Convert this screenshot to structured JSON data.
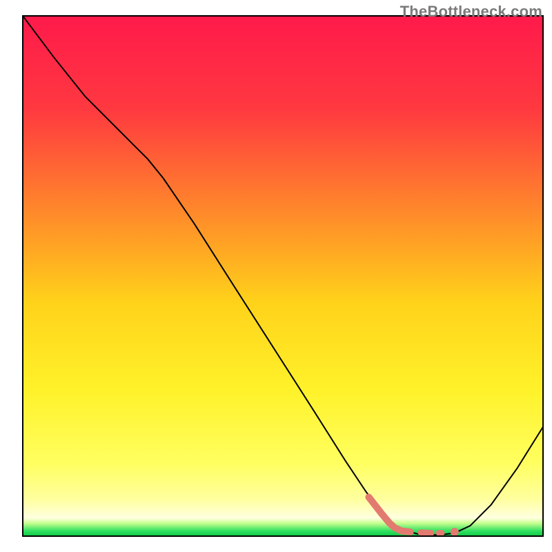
{
  "watermark": "TheBottleneck.com",
  "chart_data": {
    "type": "line",
    "title": "",
    "xlabel": "",
    "ylabel": "",
    "xlim": [
      0,
      100
    ],
    "ylim": [
      0,
      100
    ],
    "x_plot_range": [
      33,
      787
    ],
    "y_plot_range": [
      23,
      777
    ],
    "gradient_stops": [
      {
        "offset": 0.0,
        "color": "#ff1a4b"
      },
      {
        "offset": 0.18,
        "color": "#ff3940"
      },
      {
        "offset": 0.38,
        "color": "#ff8a2a"
      },
      {
        "offset": 0.55,
        "color": "#ffd21a"
      },
      {
        "offset": 0.72,
        "color": "#fff22a"
      },
      {
        "offset": 0.86,
        "color": "#ffff60"
      },
      {
        "offset": 0.93,
        "color": "#ffffa0"
      },
      {
        "offset": 0.965,
        "color": "#ffffe0"
      },
      {
        "offset": 0.975,
        "color": "#c8ff90"
      },
      {
        "offset": 0.99,
        "color": "#30e060"
      },
      {
        "offset": 1.0,
        "color": "#10c848"
      }
    ],
    "series": [
      {
        "name": "bottleneck-curve",
        "stroke": "#000000",
        "stroke_width": 2.0,
        "points": [
          {
            "x": 0.0,
            "y": 100.0
          },
          {
            "x": 6.0,
            "y": 92.0
          },
          {
            "x": 12.0,
            "y": 84.5
          },
          {
            "x": 18.0,
            "y": 78.5
          },
          {
            "x": 22.0,
            "y": 74.5
          },
          {
            "x": 24.0,
            "y": 72.5
          },
          {
            "x": 27.0,
            "y": 68.8
          },
          {
            "x": 33.0,
            "y": 60.0
          },
          {
            "x": 40.0,
            "y": 49.0
          },
          {
            "x": 48.0,
            "y": 36.5
          },
          {
            "x": 56.0,
            "y": 24.0
          },
          {
            "x": 62.0,
            "y": 14.5
          },
          {
            "x": 66.0,
            "y": 8.5
          },
          {
            "x": 69.0,
            "y": 4.5
          },
          {
            "x": 71.0,
            "y": 2.5
          },
          {
            "x": 73.0,
            "y": 1.2
          },
          {
            "x": 76.0,
            "y": 0.4
          },
          {
            "x": 80.0,
            "y": 0.2
          },
          {
            "x": 83.0,
            "y": 0.6
          },
          {
            "x": 86.0,
            "y": 2.0
          },
          {
            "x": 90.0,
            "y": 6.0
          },
          {
            "x": 95.0,
            "y": 13.0
          },
          {
            "x": 100.0,
            "y": 21.0
          }
        ]
      },
      {
        "name": "bottom-highlight",
        "stroke": "#e37a70",
        "stroke_width": 10,
        "linecap": "round",
        "points": [
          {
            "x": 66.5,
            "y": 7.5
          },
          {
            "x": 69.0,
            "y": 4.3
          },
          {
            "x": 70.5,
            "y": 2.5
          },
          {
            "x": 71.5,
            "y": 1.6
          },
          {
            "x": 72.8,
            "y": 1.0
          },
          {
            "x": 74.5,
            "y": 0.8
          }
        ]
      }
    ],
    "dash_segments": {
      "stroke": "#e37a70",
      "stroke_width": 9,
      "linecap": "round",
      "segments": [
        {
          "x1": 76.5,
          "y1": 0.7,
          "x2": 78.5,
          "y2": 0.6
        },
        {
          "x1": 80.0,
          "y1": 0.6,
          "x2": 80.5,
          "y2": 0.6
        }
      ]
    },
    "dot": {
      "fill": "#e37a70",
      "radius": 6,
      "x": 83.0,
      "y": 0.8
    }
  }
}
